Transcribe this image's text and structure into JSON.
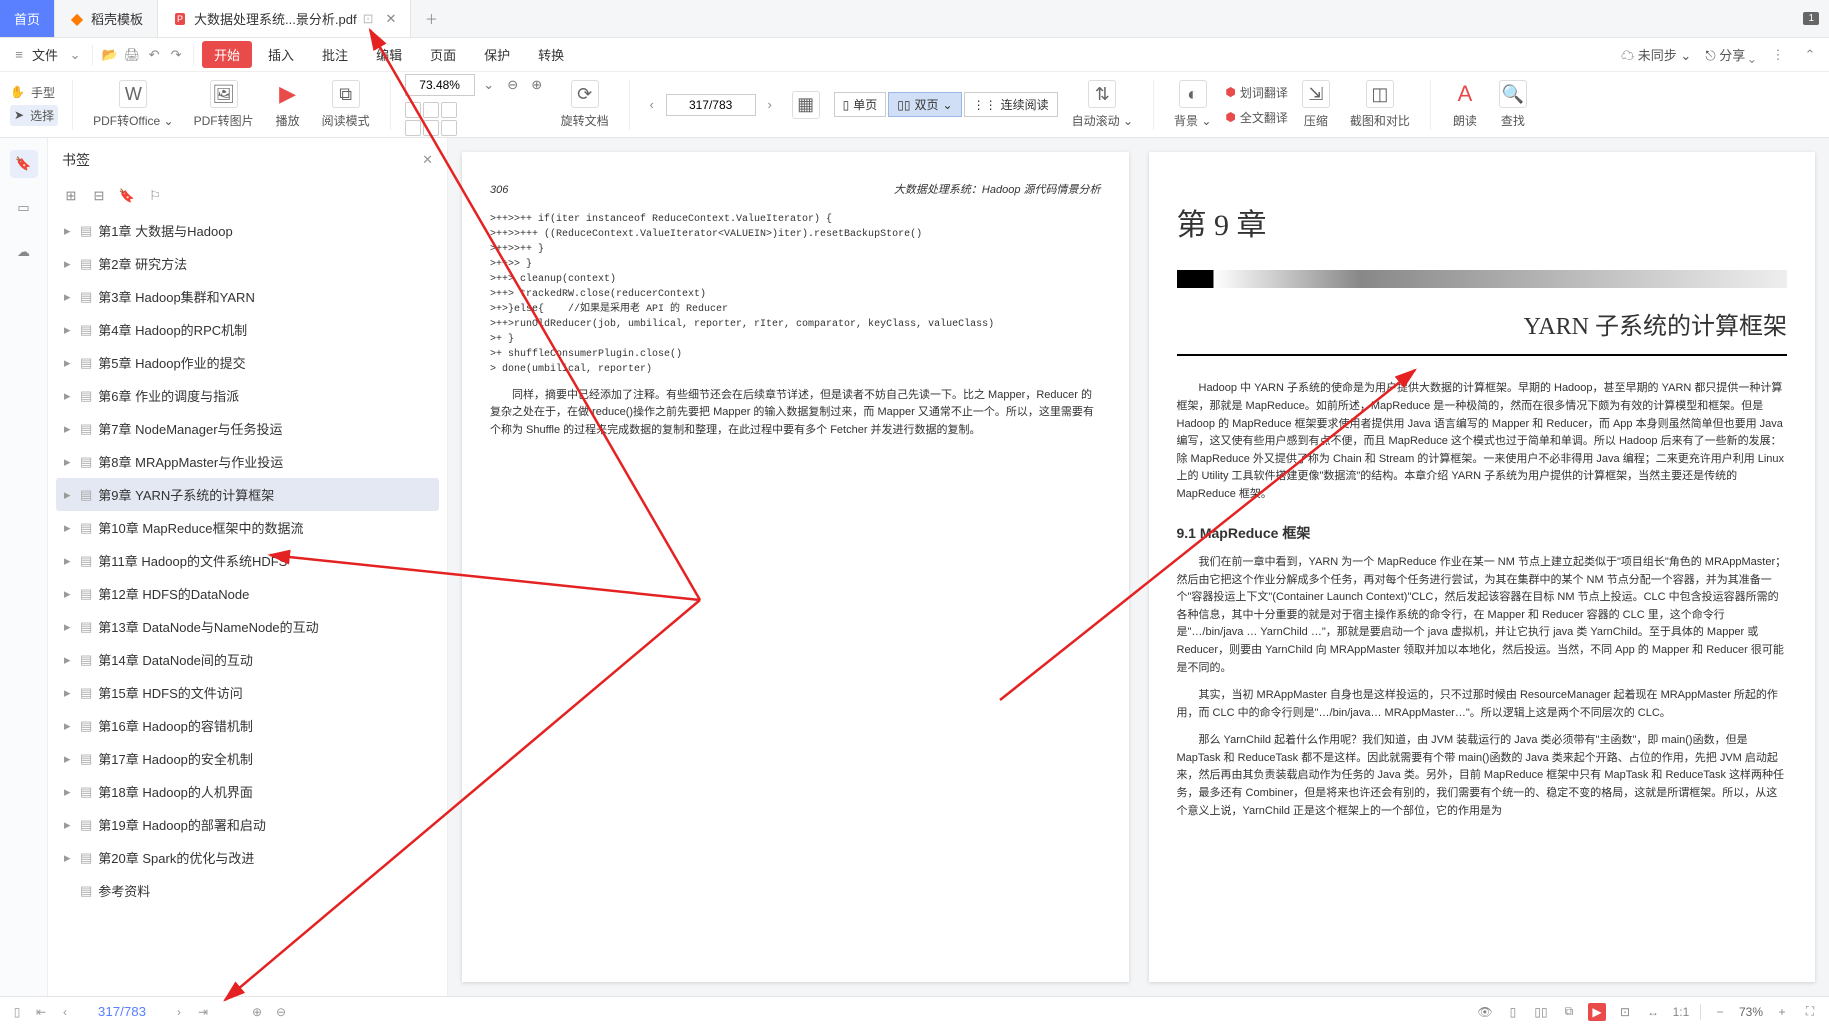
{
  "tabs": {
    "home": "首页",
    "docker": "稻壳模板",
    "active": "大数据处理系统...景分析.pdf",
    "badge": "1"
  },
  "menu": {
    "burger": "≡",
    "file": "文件",
    "start": "开始",
    "insert": "插入",
    "annotate": "批注",
    "edit": "编辑",
    "page": "页面",
    "protect": "保护",
    "convert": "转换",
    "sync": "未同步",
    "share": "分享"
  },
  "toolbar": {
    "hand": "手型",
    "select": "选择",
    "pdf2office": "PDF转Office",
    "pdf2img": "PDF转图片",
    "play": "播放",
    "readmode": "阅读模式",
    "zoom": "73.48%",
    "rotate": "旋转文档",
    "page_current": "317",
    "page_total": "/783",
    "single": "单页",
    "double": "双页",
    "continuous": "连续阅读",
    "autoscroll": "自动滚动",
    "background": "背景",
    "dict": "划词翻译",
    "fulltrans": "全文翻译",
    "compress": "压缩",
    "screenshot": "截图和对比",
    "read": "朗读",
    "find": "查找"
  },
  "sidebar": {
    "title": "书签",
    "toc": [
      "第1章  大数据与Hadoop",
      "第2章  研究方法",
      "第3章  Hadoop集群和YARN",
      "第4章  Hadoop的RPC机制",
      "第5章  Hadoop作业的提交",
      "第6章  作业的调度与指派",
      "第7章  NodeManager与任务投运",
      "第8章  MRAppMaster与作业投运",
      "第9章  YARN子系统的计算框架",
      "第10章  MapReduce框架中的数据流",
      "第11章  Hadoop的文件系统HDFS",
      "第12章  HDFS的DataNode",
      "第13章  DataNode与NameNode的互动",
      "第14章  DataNode间的互动",
      "第15章  HDFS的文件访问",
      "第16章  Hadoop的容错机制",
      "第17章  Hadoop的安全机制",
      "第18章  Hadoop的人机界面",
      "第19章  Hadoop的部署和启动",
      "第20章  Spark的优化与改进",
      "参考资料"
    ],
    "selected_index": 8
  },
  "leftpage": {
    "num": "306",
    "header": "大数据处理系统：Hadoop 源代码情景分析",
    "code": ">++>>++ if(iter instanceof ReduceContext.ValueIterator) {\n>++>>+++ ((ReduceContext.ValueIterator<VALUEIN>)iter).resetBackupStore()\n>++>>++ }\n>++>> }\n>++> cleanup(context)\n>++> trackedRW.close(reducerContext)\n>+>}else{    //如果是采用老 API 的 Reducer\n>++>runOldReducer(job, umbilical, reporter, rIter, comparator, keyClass, valueClass)\n>+ }\n>+ shuffleConsumerPlugin.close()\n> done(umbilical, reporter)",
    "p1": "同样，摘要中已经添加了注释。有些细节还会在后续章节详述，但是读者不妨自己先读一下。比之 Mapper，Reducer 的复杂之处在于，在做 reduce()操作之前先要把 Mapper 的输入数据复制过来，而 Mapper 又通常不止一个。所以，这里需要有个称为 Shuffle 的过程来完成数据的复制和整理，在此过程中要有多个 Fetcher 并发进行数据的复制。"
  },
  "rightpage": {
    "chapter_label": "第 9 章",
    "chapter_title": "YARN 子系统的计算框架",
    "p1": "Hadoop 中 YARN 子系统的使命是为用户提供大数据的计算框架。早期的 Hadoop，甚至早期的 YARN 都只提供一种计算框架，那就是 MapReduce。如前所述，MapReduce 是一种极简的，然而在很多情况下颇为有效的计算模型和框架。但是 Hadoop 的 MapReduce 框架要求使用者提供用 Java 语言编写的 Mapper 和 Reducer，而 App 本身则虽然简单但也要用 Java 编写，这又使有些用户感到有点不便，而且 MapReduce 这个模式也过于简单和单调。所以 Hadoop 后来有了一些新的发展：除 MapReduce 外又提供了称为 Chain 和 Stream 的计算框架。一来使用户不必非得用 Java 编程；二来更充许用户利用 Linux 上的 Utility 工具软件搭建更像\"数据流\"的结构。本章介绍 YARN 子系统为用户提供的计算框架，当然主要还是传统的 MapReduce 框架。",
    "section": "9.1  MapReduce 框架",
    "p2": "我们在前一章中看到，YARN 为一个 MapReduce 作业在某一 NM 节点上建立起类似于\"项目组长\"角色的 MRAppMaster；然后由它把这个作业分解成多个任务，再对每个任务进行尝试，为其在集群中的某个 NM 节点分配一个容器，并为其准备一个\"容器投运上下文\"(Container Launch Context)\"CLC，然后发起该容器在目标 NM 节点上投运。CLC 中包含投运容器所需的各种信息，其中十分重要的就是对于宿主操作系统的命令行，在 Mapper 和 Reducer 容器的 CLC 里，这个命令行是\"…/bin/java … YarnChild …\"，那就是要启动一个 java 虚拟机，并让它执行 java 类 YarnChild。至于具体的 Mapper 或 Reducer，则要由 YarnChild 向 MRAppMaster 领取并加以本地化，然后投运。当然，不同 App 的 Mapper 和 Reducer 很可能是不同的。",
    "p3": "其实，当初 MRAppMaster 自身也是这样投运的，只不过那时候由 ResourceManager 起着现在 MRAppMaster 所起的作用，而 CLC 中的命令行则是\"…/bin/java… MRAppMaster…\"。所以逻辑上这是两个不同层次的 CLC。",
    "p4": "那么 YarnChild 起着什么作用呢？我们知道，由 JVM 装载运行的 Java 类必须带有\"主函数\"，即 main()函数，但是 MapTask 和 ReduceTask 都不是这样。因此就需要有个带 main()函数的 Java 类来起个开路、占位的作用，先把 JVM 启动起来，然后再由其负责装载启动作为任务的 Java 类。另外，目前 MapReduce 框架中只有 MapTask 和 ReduceTask 这样两种任务，最多还有 Combiner，但是将来也许还会有别的，我们需要有个统一的、稳定不变的格局，这就是所谓框架。所以，从这个意义上说，YarnChild 正是这个框架上的一个部位，它的作用是为"
  },
  "status": {
    "page_current": "317",
    "page_total": "/783",
    "zoom": "73%"
  }
}
